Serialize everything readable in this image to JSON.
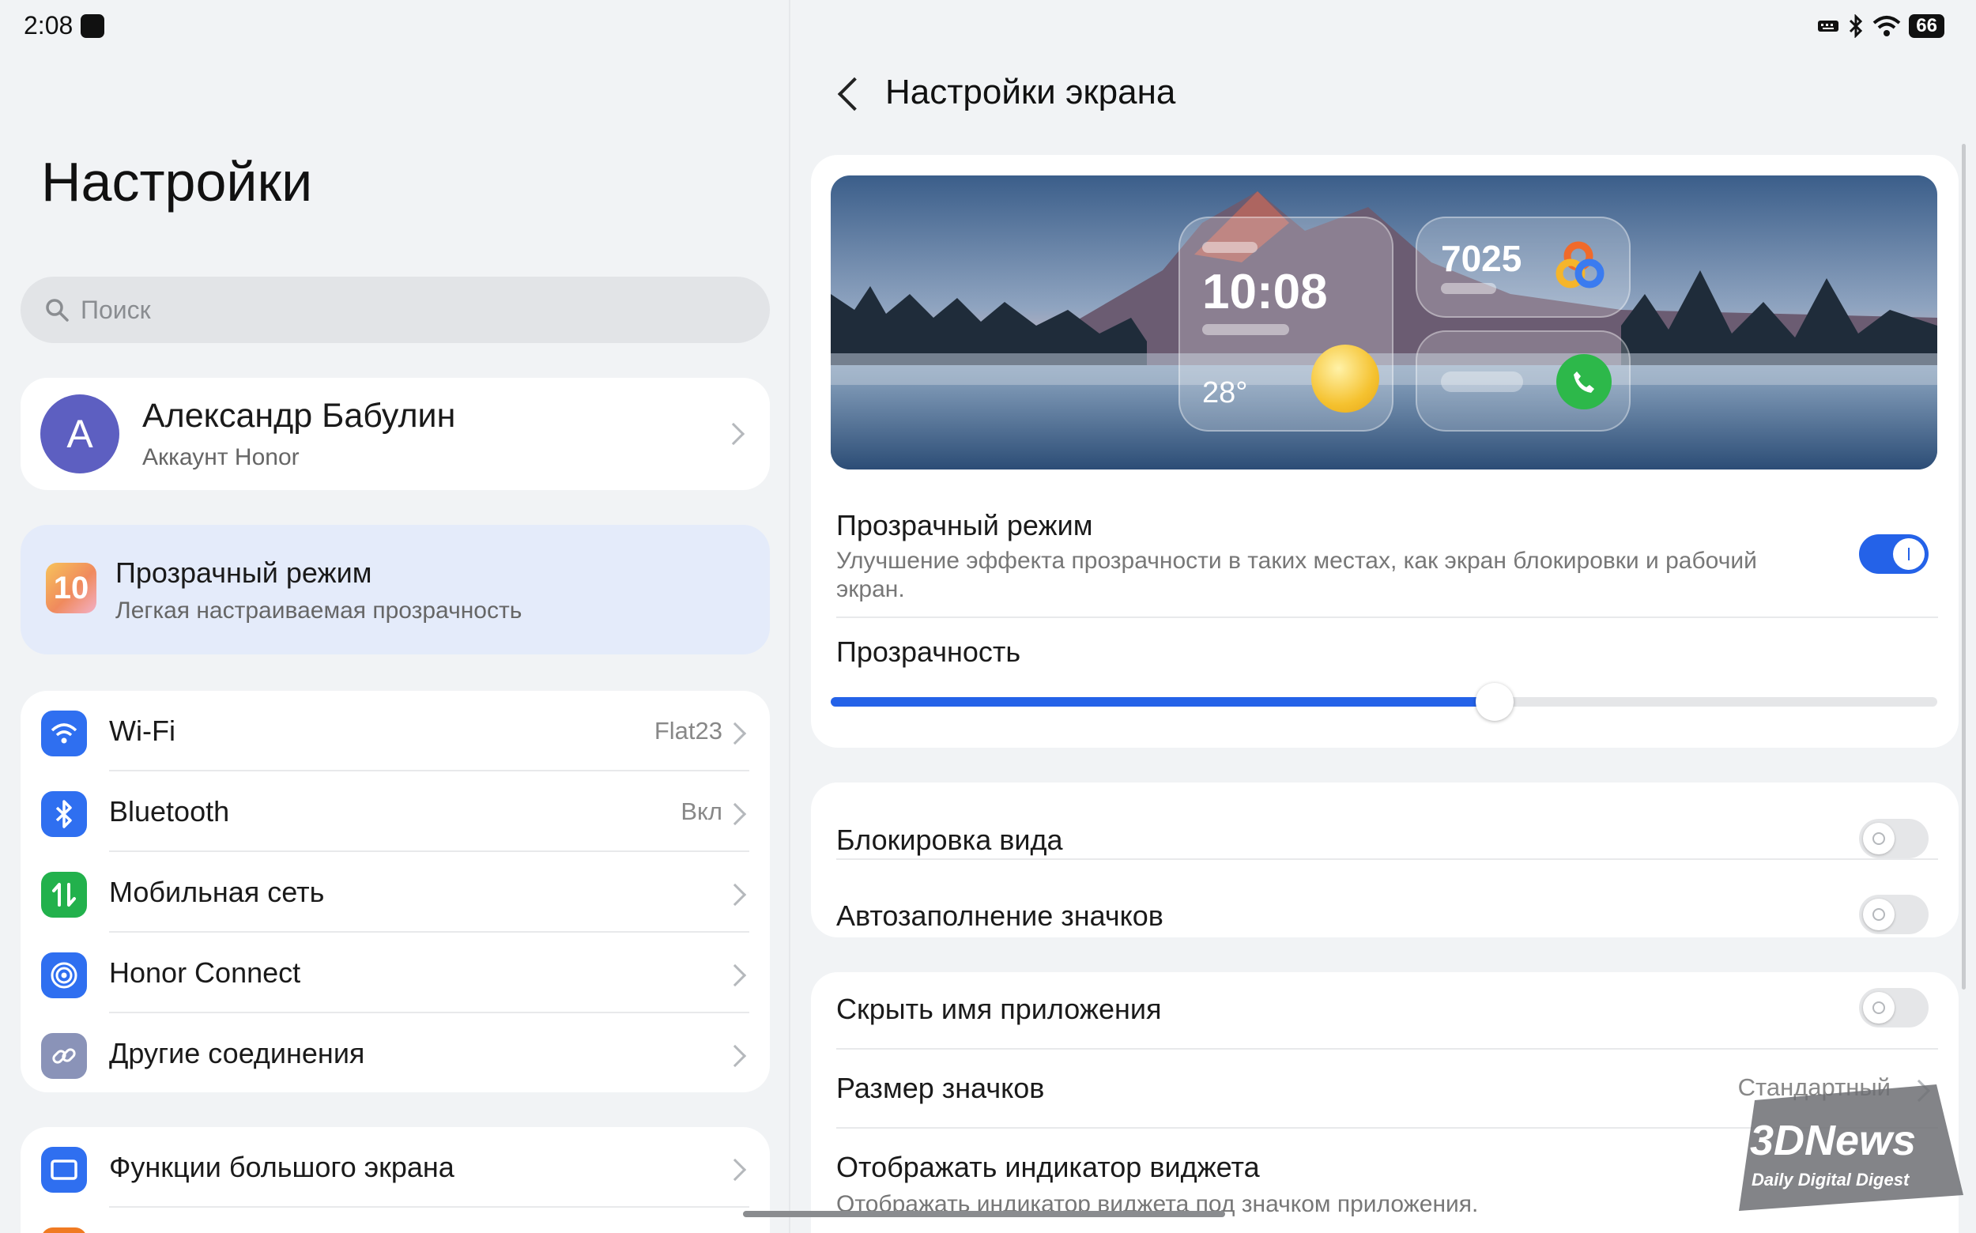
{
  "status_bar": {
    "time": "2:08",
    "battery": "66",
    "icons": [
      "app-notification-icon",
      "keyboard-icon",
      "bluetooth-icon",
      "wifi-icon",
      "battery-icon"
    ]
  },
  "left": {
    "title": "Настройки",
    "search_placeholder": "Поиск",
    "account": {
      "initial": "А",
      "name": "Александр Бабулин",
      "subtitle": "Аккаунт Honor"
    },
    "promo": {
      "icon_text": "10",
      "title": "Прозрачный режим",
      "subtitle": "Легкая настраиваемая прозрачность"
    },
    "items": [
      {
        "label": "Wi-Fi",
        "value": "Flat23",
        "icon": "wifi-icon",
        "color": "#2f6ff0"
      },
      {
        "label": "Bluetooth",
        "value": "Вкл",
        "icon": "bluetooth-icon",
        "color": "#2f6ff0"
      },
      {
        "label": "Мобильная сеть",
        "value": "",
        "icon": "mobile-network-icon",
        "color": "#22b14c"
      },
      {
        "label": "Honor Connect",
        "value": "",
        "icon": "honor-connect-icon",
        "color": "#2f6ff0"
      },
      {
        "label": "Другие соединения",
        "value": "",
        "icon": "link-icon",
        "color": "#8a93b8"
      }
    ],
    "items2": [
      {
        "label": "Функции большого экрана",
        "icon": "large-screen-icon",
        "color": "#2f6ff0"
      }
    ]
  },
  "right": {
    "title": "Настройки экрана",
    "preview": {
      "clock": "10:08",
      "temp": "28°",
      "steps": "7025"
    },
    "transparent_mode": {
      "title": "Прозрачный режим",
      "subtitle": "Улучшение эффекта прозрачности в таких местах, как экран блокировки и рабочий экран.",
      "enabled": true
    },
    "transparency": {
      "title": "Прозрачность",
      "value_percent": 60
    },
    "lock_layout": {
      "title": "Блокировка вида",
      "enabled": false
    },
    "autofill_icons": {
      "title": "Автозаполнение значков",
      "enabled": false
    },
    "hide_app_name": {
      "title": "Скрыть имя приложения",
      "enabled": false
    },
    "icon_size": {
      "title": "Размер значков",
      "value": "Стандартный"
    },
    "widget_indicator": {
      "title": "Отображать индикатор виджета",
      "subtitle": "Отображать индикатор виджета под значком приложения."
    }
  },
  "watermark": {
    "brand": "3DNews",
    "tagline": "Daily Digital Digest"
  },
  "colors": {
    "accent": "#2462e8",
    "background": "#f1f3f5",
    "card": "#ffffff",
    "promo_bg": "#e4ebfa",
    "avatar": "#5d5fc1",
    "call_green": "#2db84a"
  }
}
